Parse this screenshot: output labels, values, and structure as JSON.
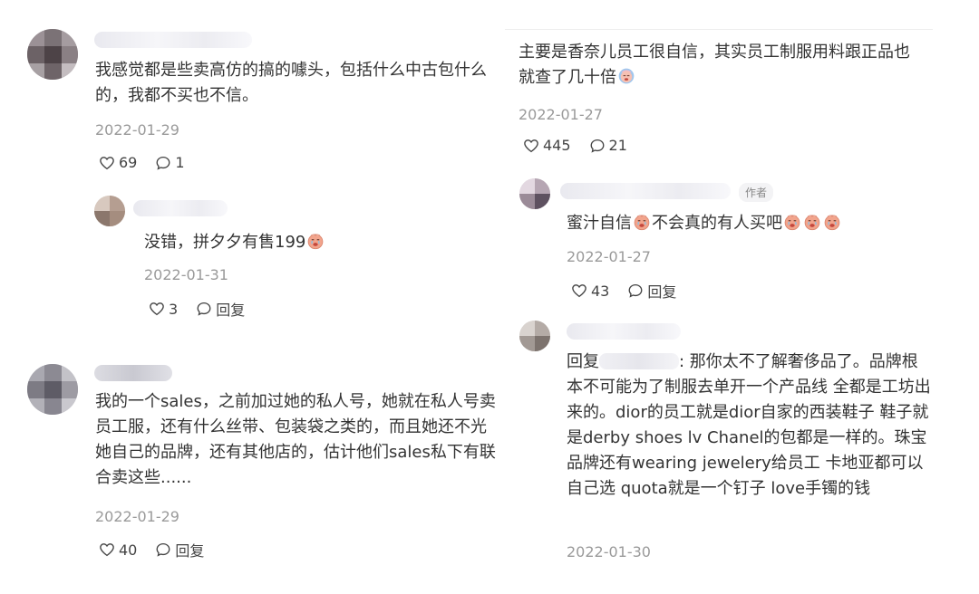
{
  "left": {
    "c1": {
      "text": "我感觉都是些卖高仿的搞的噱头，包括什么中古包什么的，我都不买也不信。",
      "date": "2022-01-29",
      "likes": "69",
      "replies": "1"
    },
    "c1_reply": {
      "text": "没错，拼夕夕有售199",
      "date": "2022-01-31",
      "likes": "3",
      "reply_label": "回复"
    },
    "c2": {
      "text": "我的一个sales，之前加过她的私人号，她就在私人号卖员工服，还有什么丝带、包装袋之类的，而且她还不光她自己的品牌，还有其他店的，估计他们sales私下有联合卖这些......",
      "date": "2022-01-29",
      "likes": "40",
      "reply_label": "回复"
    }
  },
  "right": {
    "c1": {
      "text": "主要是香奈儿员工很自信，其实员工制服用料跟正品也就查了几十倍",
      "date": "2022-01-27",
      "likes": "445",
      "replies": "21"
    },
    "r1": {
      "author_tag": "作者",
      "text_a": "蜜汁自信",
      "text_b": "不会真的有人买吧",
      "date": "2022-01-27",
      "likes": "43",
      "reply_label": "回复"
    },
    "r2": {
      "prefix": "回复",
      "text": ": 那你太不了解奢侈品了。品牌根本不可能为了制服去单开一个产品线 全都是工坊出来的。dior的员工就是dior自家的西装鞋子 鞋子就是derby shoes lv Chanel的包都是一样的。珠宝品牌还有wearing jewelery给员工 卡地亚都可以自己选 quota就是一个钉子 love手镯的钱",
      "date": "2022-01-30"
    }
  },
  "icons": {
    "like": "heart-outline-icon",
    "comment": "speech-bubble-icon",
    "emoji": "crying-face-emoji"
  },
  "colors": {
    "text": "#333333",
    "meta": "#9a9a9a",
    "emoji": "#f2a48c"
  }
}
